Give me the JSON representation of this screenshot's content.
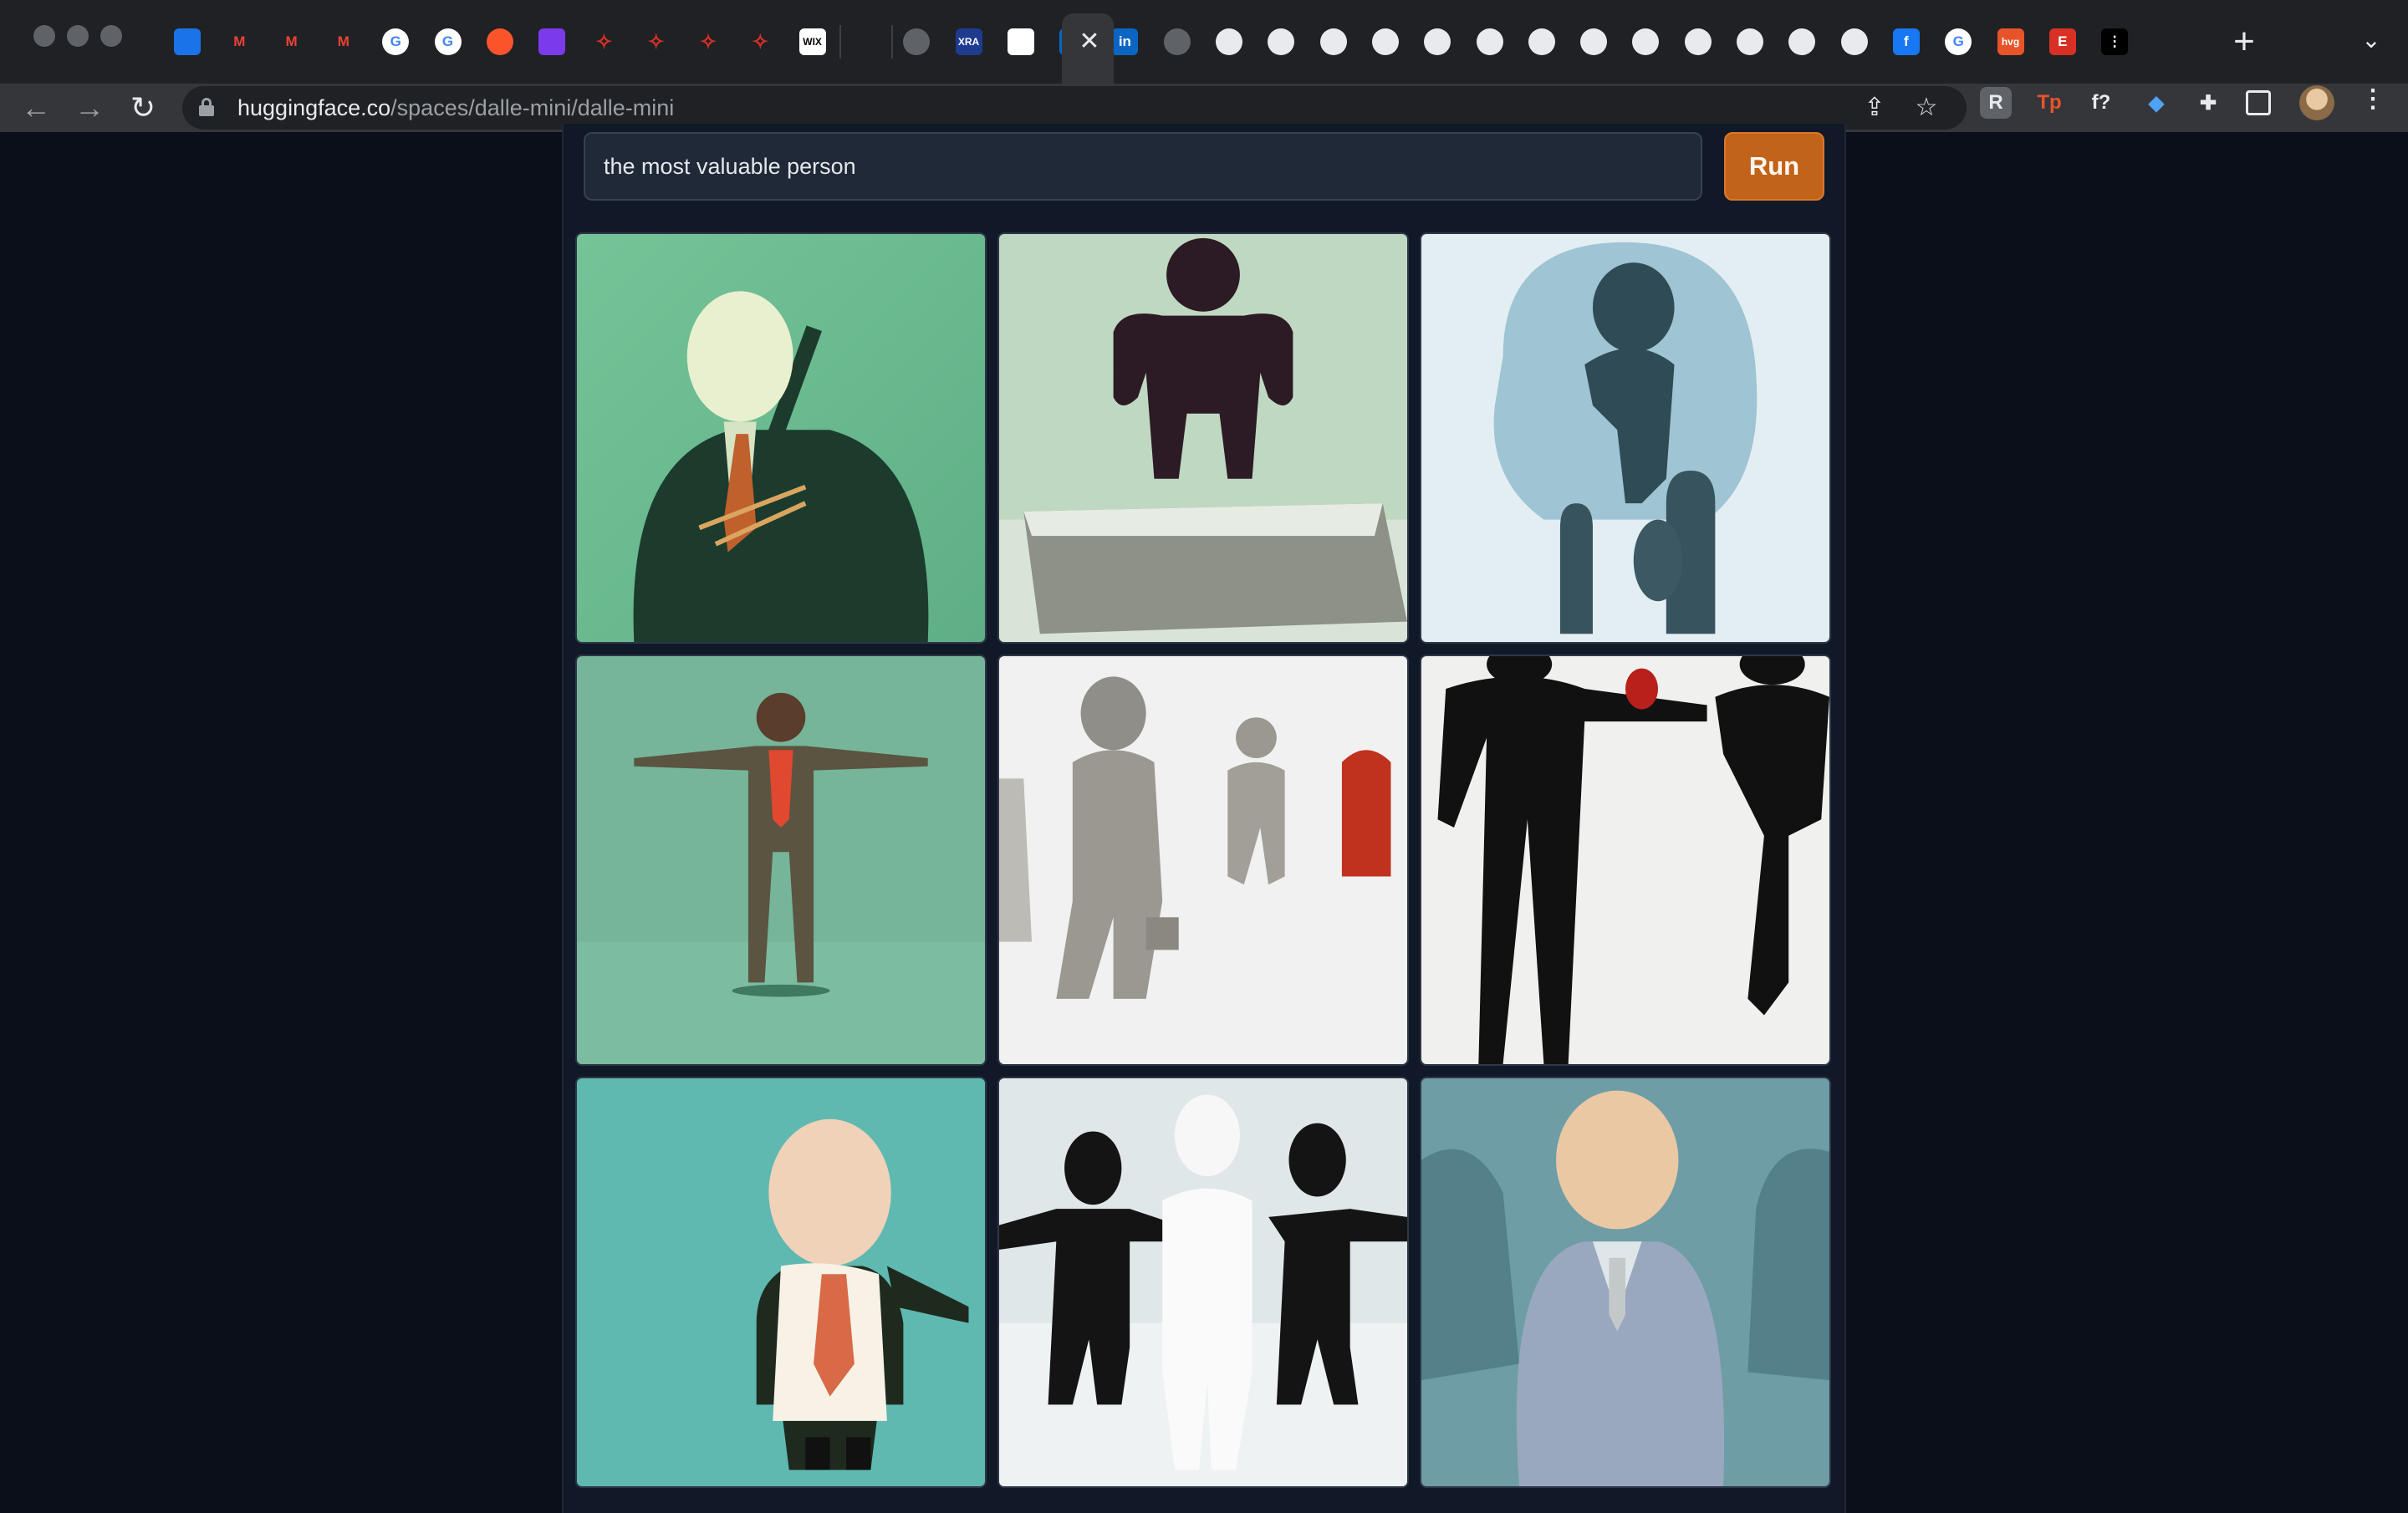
{
  "browser": {
    "url_host": "huggingface.co",
    "url_path": "/spaces/dalle-mini/dalle-mini",
    "tab_close_glyph": "✕",
    "new_tab_glyph": "+",
    "tab_list_glyph": "⌄",
    "menu_glyph": "⋮",
    "back_glyph": "←",
    "forward_glyph": "→",
    "reload_glyph": "↻",
    "share_glyph": "⇪",
    "bookmark_glyph": "☆",
    "tab_icons": [
      "gem-icon",
      "gmail-icon",
      "gmail-icon",
      "gmail-icon",
      "google-icon",
      "google-icon",
      "brave-icon",
      "obsidian-icon",
      "rocket-icon",
      "rocket-icon",
      "rocket-icon",
      "rocket-icon",
      "wix-icon",
      "blank-icon",
      "globe-icon",
      "xra-icon",
      "white-square-icon",
      "linkedin-icon",
      "linkedin-icon",
      "globe-icon",
      "gear-icon",
      "gear-icon",
      "gear-icon",
      "gear-icon",
      "gear-icon",
      "gear-icon",
      "gear-icon",
      "gear-icon",
      "gear-icon",
      "gear-icon",
      "gear-icon",
      "gear-icon",
      "github-icon",
      "facebook-icon",
      "google-icon",
      "hvg-icon",
      "etsy-icon",
      "dots-icon"
    ],
    "tab_labels": {
      "wix": "WIX",
      "xra": "XRA",
      "linkedin": "in",
      "facebook": "f",
      "google": "G",
      "gmail": "M",
      "hvg": "hvg",
      "etsy": "E"
    },
    "extensions": [
      {
        "name": "r-extension-icon",
        "label": "R"
      },
      {
        "name": "tp-extension-icon",
        "label": "Tp"
      },
      {
        "name": "font-extension-icon",
        "label": "f?"
      },
      {
        "name": "gem-extension-icon",
        "label": ""
      },
      {
        "name": "puzzle-extensions-icon",
        "label": ""
      },
      {
        "name": "sidepanel-icon",
        "label": ""
      }
    ]
  },
  "app": {
    "prompt_value": "the most valuable person",
    "run_label": "Run",
    "results": [
      {
        "name": "result-businessman-green"
      },
      {
        "name": "result-figure-on-podium"
      },
      {
        "name": "result-figure-head-silhouette"
      },
      {
        "name": "result-figure-arms-out"
      },
      {
        "name": "result-gray-figures-walking"
      },
      {
        "name": "result-black-figures-shaking"
      },
      {
        "name": "result-bald-man-tie"
      },
      {
        "name": "result-three-figures"
      },
      {
        "name": "result-faceless-suit"
      }
    ]
  },
  "colors": {
    "page_bg": "#0b0f19",
    "panel_bg": "#111827",
    "input_bg": "#1f2937",
    "run_button": "#c2631b",
    "chrome_bg": "#202124",
    "toolbar_bg": "#35363a"
  }
}
